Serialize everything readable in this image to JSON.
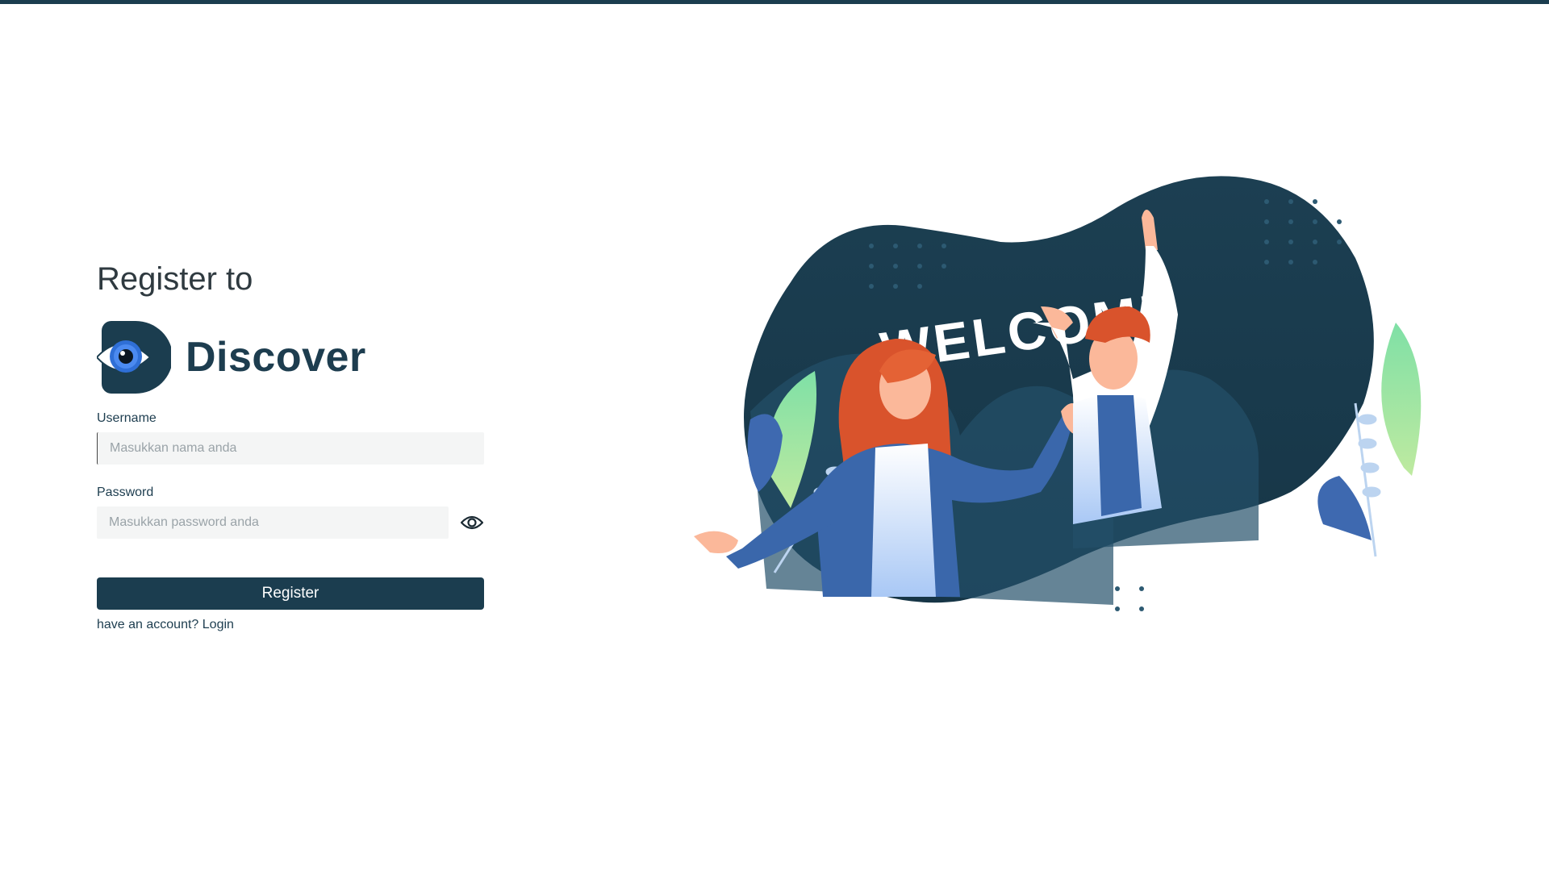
{
  "page": {
    "heading": "Register to",
    "brand_name": "Discover"
  },
  "form": {
    "username_label": "Username",
    "username_placeholder": "Masukkan nama anda",
    "password_label": "Password",
    "password_placeholder": "Masukkan password anda",
    "register_label": "Register",
    "have_account_text": "have an account? ",
    "login_link": "Login"
  },
  "illustration": {
    "welcome_text": "WELCOME"
  },
  "icons": {
    "logo": "eye-logo-icon",
    "toggle_password": "eye-icon"
  },
  "colors": {
    "primary": "#1b3d4f",
    "input_bg": "#f4f5f5",
    "page_bg": "#ffffff"
  }
}
